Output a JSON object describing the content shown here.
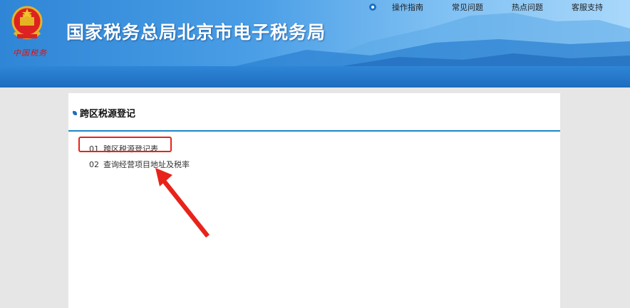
{
  "header": {
    "title": "国家税务总局北京市电子税务局",
    "brand_text": "中国税务",
    "nav": [
      {
        "label": "操作指南"
      },
      {
        "label": "常见问题"
      },
      {
        "label": "热点问题"
      },
      {
        "label": "客服支持"
      }
    ]
  },
  "panel": {
    "title": "跨区税源登记",
    "items": [
      {
        "num": "01",
        "label": "跨区税源登记表"
      },
      {
        "num": "02",
        "label": "查询经营项目地址及税率"
      }
    ]
  },
  "colors": {
    "header_blue": "#2f86d6",
    "rule_blue": "#1d86c6",
    "highlight_red": "#e8231a"
  },
  "icons": [
    "national-emblem-icon",
    "radio-dot-icon",
    "title-bullet-icon",
    "arrow-annotation-icon"
  ]
}
